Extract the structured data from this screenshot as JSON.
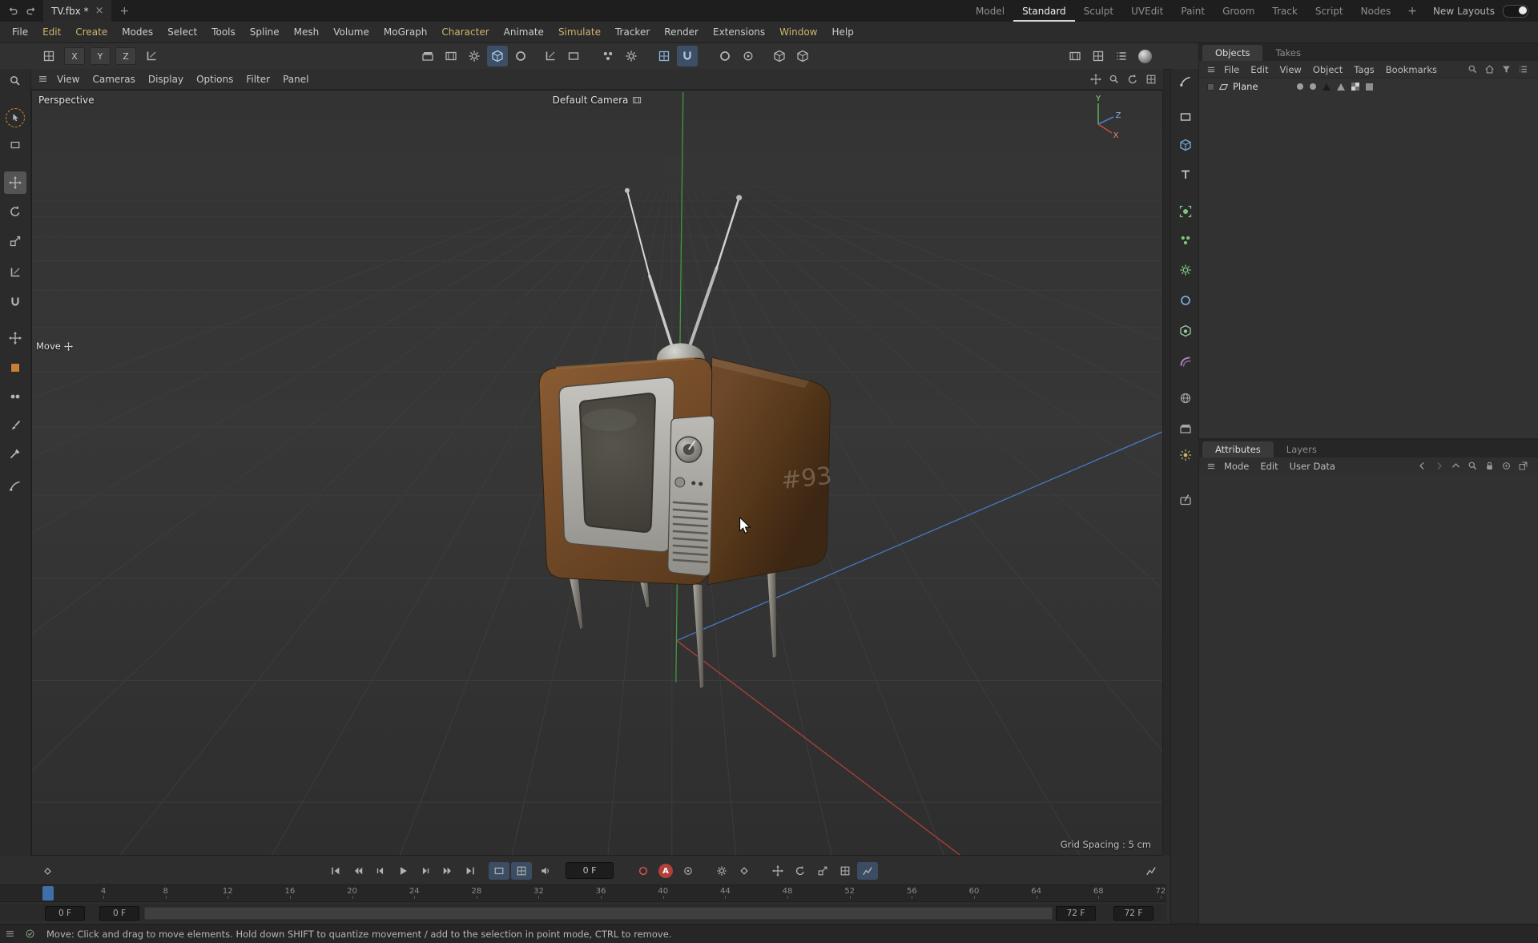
{
  "titlebar": {
    "tab_title": "TV.fbx *",
    "close_label": "×",
    "add_tab_label": "+",
    "layouts": [
      "Model",
      "Standard",
      "Sculpt",
      "UVEdit",
      "Paint",
      "Groom",
      "Track",
      "Script",
      "Nodes"
    ],
    "active_layout": "Standard",
    "add_layout_label": "+",
    "new_layouts_label": "New Layouts"
  },
  "menubar": {
    "items": [
      "File",
      "Edit",
      "Create",
      "Modes",
      "Select",
      "Tools",
      "Spline",
      "Mesh",
      "Volume",
      "MoGraph",
      "Character",
      "Animate",
      "Simulate",
      "Tracker",
      "Render",
      "Extensions",
      "Window",
      "Help"
    ]
  },
  "toolbar": {
    "axis_x": "X",
    "axis_y": "Y",
    "axis_z": "Z"
  },
  "viewport": {
    "menus": [
      "View",
      "Cameras",
      "Display",
      "Options",
      "Filter",
      "Panel"
    ],
    "view_label": "Perspective",
    "camera_label": "Default Camera",
    "tool_hint": "Move",
    "grid_spacing_label": "Grid Spacing : 5 cm",
    "axis_x": "X",
    "axis_y": "Y",
    "axis_z": "Z",
    "graffiti": "#93"
  },
  "objects_panel": {
    "tabs": [
      "Objects",
      "Takes"
    ],
    "menus": [
      "File",
      "Edit",
      "View",
      "Object",
      "Tags",
      "Bookmarks"
    ],
    "items": [
      {
        "name": "Plane"
      }
    ]
  },
  "attributes_panel": {
    "tabs": [
      "Attributes",
      "Layers"
    ],
    "menus": [
      "Mode",
      "Edit",
      "User Data"
    ]
  },
  "timeline": {
    "current_frame": "0 F",
    "autokey_label": "A",
    "ticks": [
      "4",
      "8",
      "12",
      "16",
      "20",
      "24",
      "28",
      "32",
      "36",
      "40",
      "44",
      "48",
      "52",
      "56",
      "60",
      "64",
      "68",
      "72"
    ],
    "range_start_a": "0 F",
    "range_start_b": "0 F",
    "range_end_a": "72 F",
    "range_end_b": "72 F"
  },
  "statusbar": {
    "message": "Move: Click and drag to move elements. Hold down SHIFT to quantize movement / add to the selection in point mode, CTRL to remove."
  },
  "colors": {
    "accent_blue": "#5a8fd0",
    "accent_orange": "#d0893c",
    "autokey_red": "#b04038",
    "axis_x_red": "#c05048",
    "axis_y_green": "#55b055",
    "axis_z_blue": "#5578c8"
  }
}
